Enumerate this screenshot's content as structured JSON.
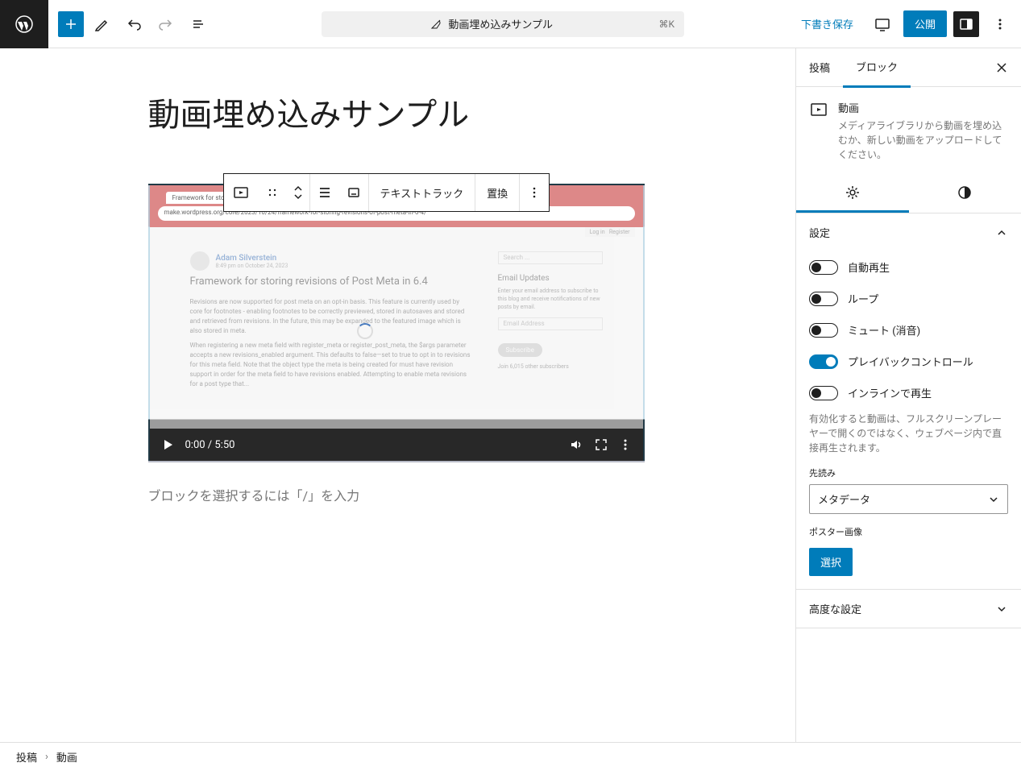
{
  "topbar": {
    "doc_title": "動画埋め込みサンプル",
    "shortcut": "⌘K",
    "save_draft": "下書き保存",
    "publish": "公開"
  },
  "editor": {
    "post_title": "動画埋め込みサンプル",
    "placeholder": "ブロックを選択するには「/」を入力"
  },
  "block_toolbar": {
    "text_track": "テキストトラック",
    "replace": "置換"
  },
  "video_preview": {
    "author": "Adam Silverstein",
    "author_meta": "8:49 pm on October 24, 2023",
    "heading": "Framework for storing revisions of Post Meta in 6.4",
    "para1": "Revisions are now supported for post meta on an opt-in basis. This feature is currently used by core for footnotes - enabling footnotes to be correctly previewed, stored in autosaves and stored and retrieved from revisions. In the future, this may be expanded to the featured image which is also stored in meta.",
    "para2": "When registering a new meta field with register_meta or register_post_meta, the $args parameter accepts a new revisions_enabled argument. This defaults to false—set to true to opt in to revisions for this meta field. Note that the object type the meta is being created for must have revision support in order for the meta field to have revisions enabled. Attempting to enable meta revisions for a post type that...",
    "search_ph": "Search ...",
    "side_heading": "Email Updates",
    "side_text": "Enter your email address to subscribe to this blog and receive notifications of new posts by email.",
    "email_ph": "Email Address",
    "subscribe": "Subscribe",
    "followers": "Join 6,015 other subscribers",
    "header_login": "Log in",
    "header_register": "Register",
    "time": "0:00 / 5:50",
    "url": "make.wordpress.org/core/2023/10/24/framework-for-storing-revisions-of-post-meta-in-6-4/"
  },
  "sidebar": {
    "tabs": {
      "post": "投稿",
      "block": "ブロック"
    },
    "block_title": "動画",
    "block_desc": "メディアライブラリから動画を埋め込むか、新しい動画をアップロードしてください。",
    "settings_panel": "設定",
    "toggles": {
      "autoplay": "自動再生",
      "loop": "ループ",
      "muted": "ミュート (消音)",
      "playback": "プレイバックコントロール",
      "inline": "インラインで再生"
    },
    "inline_help": "有効化すると動画は、フルスクリーンプレーヤーで開くのではなく、ウェブページ内で直接再生されます。",
    "preload_label": "先読み",
    "preload_value": "メタデータ",
    "poster_label": "ポスター画像",
    "poster_button": "選択",
    "advanced_panel": "高度な設定"
  },
  "breadcrumb": {
    "root": "投稿",
    "current": "動画"
  }
}
